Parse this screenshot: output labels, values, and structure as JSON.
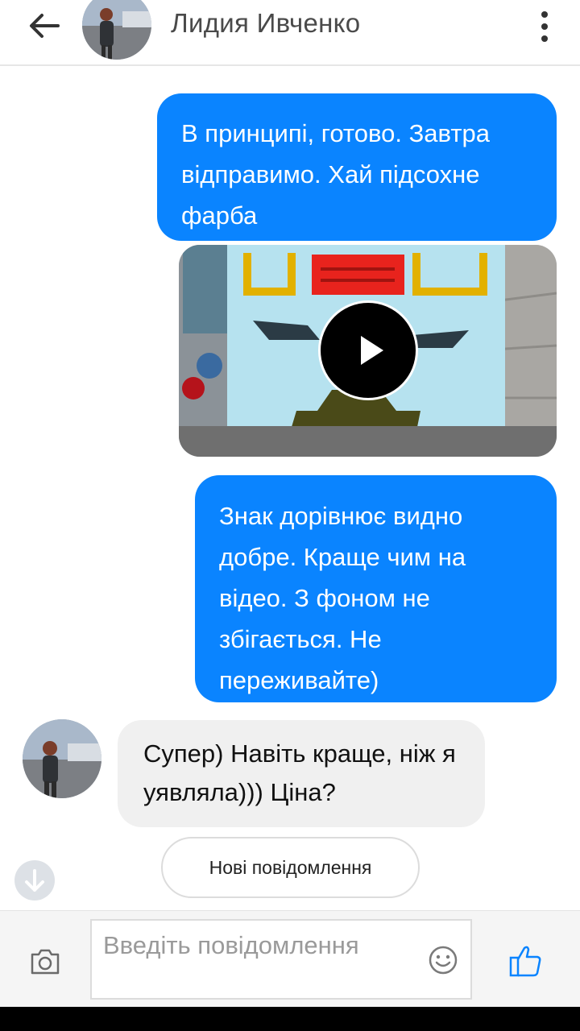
{
  "header": {
    "back_icon": "arrow-left-icon",
    "contact_name": "Лидия Ивченко",
    "more_icon": "more-vertical-icon"
  },
  "messages": [
    {
      "direction": "outgoing",
      "type": "text",
      "text": "В принципі, готово. Завтра відправимо. Хай підсохне фарба"
    },
    {
      "direction": "outgoing",
      "type": "video",
      "play_icon": "play-icon"
    },
    {
      "direction": "outgoing",
      "type": "text",
      "text": "Знак дорівнює видно добре. Краще чим на відео. З фоном не збігається. Не переживайте)"
    },
    {
      "direction": "incoming",
      "type": "text",
      "text": "Супер) Навіть краще, ніж я уявляла))) Ціна?"
    }
  ],
  "new_messages_button": "Нові повідомлення",
  "scroll_down_icon": "arrow-down-icon",
  "composer": {
    "placeholder": "Введіть повідомлення",
    "camera_icon": "camera-icon",
    "emoji_icon": "emoji-icon",
    "like_icon": "thumbs-up-icon"
  },
  "colors": {
    "outgoing_bubble": "#0a84ff",
    "incoming_bubble": "#f0f0f0",
    "accent": "#0a84ff"
  }
}
